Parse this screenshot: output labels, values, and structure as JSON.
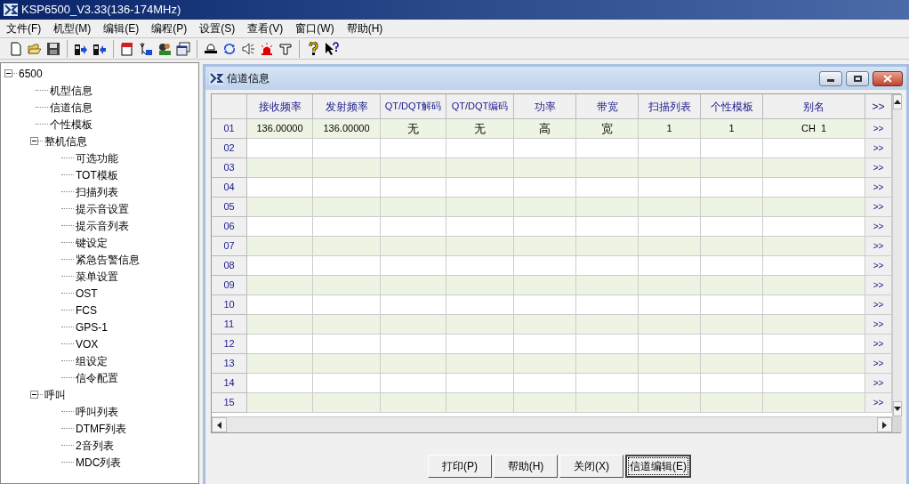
{
  "window": {
    "title": "KSP6500_V3.33(136-174MHz)"
  },
  "menu": [
    "文件(F)",
    "机型(M)",
    "编辑(E)",
    "编程(P)",
    "设置(S)",
    "查看(V)",
    "窗口(W)",
    "帮助(H)"
  ],
  "tree": {
    "label": "6500",
    "expanded": true,
    "children": [
      {
        "label": "机型信息"
      },
      {
        "label": "信道信息"
      },
      {
        "label": "个性模板"
      },
      {
        "label": "整机信息",
        "expanded": true,
        "children": [
          {
            "label": "可选功能"
          },
          {
            "label": "TOT模板"
          },
          {
            "label": "扫描列表"
          },
          {
            "label": "提示音设置"
          },
          {
            "label": "提示音列表"
          },
          {
            "label": "键设定"
          },
          {
            "label": "紧急告警信息"
          },
          {
            "label": "菜单设置"
          },
          {
            "label": "OST"
          },
          {
            "label": "FCS"
          },
          {
            "label": "GPS-1"
          },
          {
            "label": "VOX"
          },
          {
            "label": "组设定"
          },
          {
            "label": "信令配置"
          }
        ]
      },
      {
        "label": "呼叫",
        "expanded": true,
        "children": [
          {
            "label": "呼叫列表"
          },
          {
            "label": "DTMF列表"
          },
          {
            "label": "2音列表"
          },
          {
            "label": "MDC列表"
          }
        ]
      }
    ]
  },
  "child_window": {
    "title": "信道信息"
  },
  "table": {
    "columns": [
      "接收频率",
      "发射频率",
      "QT/DQT解码",
      "QT/DQT编码",
      "功率",
      "带宽",
      "扫描列表",
      "个性模板",
      "别名",
      ">>"
    ],
    "rows": [
      {
        "number": "01",
        "cells": [
          "136.00000",
          "136.00000",
          "无",
          "无",
          "高",
          "宽",
          "1",
          "1",
          "CH  1"
        ],
        "more": ">>"
      },
      {
        "number": "02",
        "more": ">>"
      },
      {
        "number": "03",
        "more": ">>"
      },
      {
        "number": "04",
        "more": ">>"
      },
      {
        "number": "05",
        "more": ">>"
      },
      {
        "number": "06",
        "more": ">>"
      },
      {
        "number": "07",
        "more": ">>"
      },
      {
        "number": "08",
        "more": ">>"
      },
      {
        "number": "09",
        "more": ">>"
      },
      {
        "number": "10",
        "more": ">>"
      },
      {
        "number": "11",
        "more": ">>"
      },
      {
        "number": "12",
        "more": ">>"
      },
      {
        "number": "13",
        "more": ">>"
      },
      {
        "number": "14",
        "more": ">>"
      },
      {
        "number": "15",
        "more": ">>"
      }
    ]
  },
  "buttons": [
    {
      "label": "打印(P)",
      "default": false
    },
    {
      "label": "帮助(H)",
      "default": false
    },
    {
      "label": "关闭(X)",
      "default": false
    },
    {
      "label": "信道编辑(E)",
      "default": true
    }
  ]
}
